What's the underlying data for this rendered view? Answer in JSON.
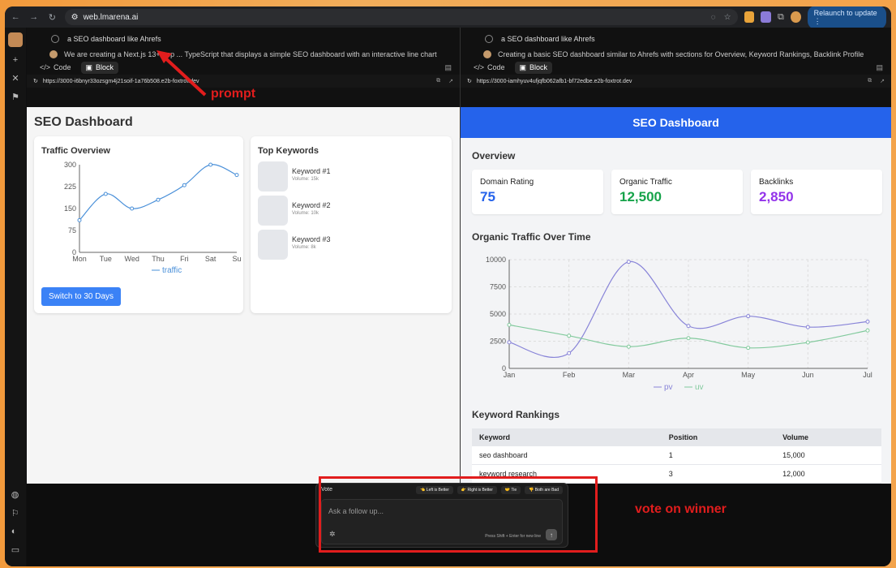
{
  "browser": {
    "url": "web.lmarena.ai",
    "relaunch_label": "Relaunch to update"
  },
  "left": {
    "prompt": "a SEO dashboard like Ahrefs",
    "reply": "We are creating a Next.js 13+ app ... TypeScript that displays a simple SEO dashboard with an interactive line chart",
    "tab_code": "Code",
    "tab_block": "Block",
    "preview_url": "https://3000-i6bnyr33ozsgm4j21soif-1a76b508.e2b-foxtrot.dev",
    "title": "SEO Dashboard",
    "traffic_title": "Traffic Overview",
    "keywords_title": "Top Keywords",
    "switch_label": "Switch to 30 Days",
    "keywords": [
      {
        "name": "Keyword #1",
        "volume": "Volume: 15k"
      },
      {
        "name": "Keyword #2",
        "volume": "Volume: 10k"
      },
      {
        "name": "Keyword #3",
        "volume": "Volume: 8k"
      }
    ]
  },
  "right": {
    "prompt": "a SEO dashboard like Ahrefs",
    "reply": "Creating a basic SEO dashboard similar to Ahrefs with sections for Overview, Keyword Rankings, Backlink Profile",
    "tab_code": "Code",
    "tab_block": "Block",
    "preview_url": "https://3000-iamhyuv4ufjqfb062afb1-bf72edbe.e2b-foxtrot.dev",
    "header": "SEO Dashboard",
    "overview_title": "Overview",
    "metrics": [
      {
        "label": "Domain Rating",
        "value": "75",
        "color": "#2563eb"
      },
      {
        "label": "Organic Traffic",
        "value": "12,500",
        "color": "#16a34a"
      },
      {
        "label": "Backlinks",
        "value": "2,850",
        "color": "#9333ea"
      }
    ],
    "chart_title": "Organic Traffic Over Time",
    "rankings_title": "Keyword Rankings",
    "table_headers": [
      "Keyword",
      "Position",
      "Volume"
    ],
    "table_rows": [
      [
        "seo dashboard",
        "1",
        "15,000"
      ],
      [
        "keyword research",
        "3",
        "12,000"
      ]
    ]
  },
  "vote": {
    "label": "Vote",
    "left_better": "👈 Left is Better",
    "right_better": "👉 Right is Better",
    "tie": "🤝 Tie",
    "both_bad": "👎 Both are Bad",
    "placeholder": "Ask a follow up...",
    "hint": "Press Shift + Enter for new line"
  },
  "annotations": {
    "prompt": "prompt",
    "vote": "vote on winner",
    "color": "#e11d1d"
  },
  "chart_data": [
    {
      "type": "line",
      "categories": [
        "Mon",
        "Tue",
        "Wed",
        "Thu",
        "Fri",
        "Sat",
        "Su"
      ],
      "series": [
        {
          "name": "traffic",
          "values": [
            110,
            200,
            150,
            180,
            230,
            300,
            265
          ]
        }
      ],
      "ylim": [
        0,
        300
      ],
      "yticks": [
        0,
        75,
        150,
        225,
        300
      ],
      "color": "#4a90d9",
      "legend": "bottom"
    },
    {
      "type": "line",
      "categories": [
        "Jan",
        "Feb",
        "Mar",
        "Apr",
        "May",
        "Jun",
        "Jul"
      ],
      "series": [
        {
          "name": "pv",
          "values": [
            2400,
            1400,
            9800,
            3900,
            4800,
            3800,
            4300
          ],
          "color": "#8884d8"
        },
        {
          "name": "uv",
          "values": [
            4000,
            3000,
            2000,
            2780,
            1890,
            2390,
            3490
          ],
          "color": "#82ca9d"
        }
      ],
      "ylim": [
        0,
        10000
      ],
      "yticks": [
        0,
        2500,
        5000,
        7500,
        10000
      ],
      "grid": true,
      "legend": "bottom"
    }
  ]
}
